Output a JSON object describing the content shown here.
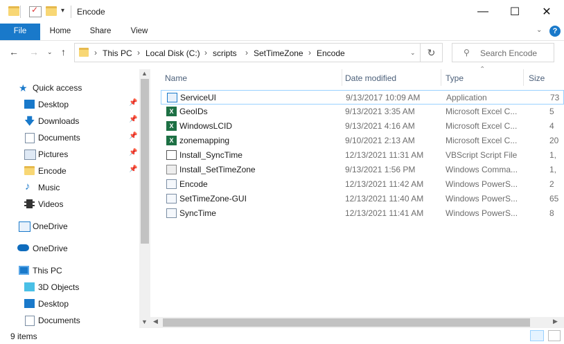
{
  "window": {
    "title": "Encode",
    "minimize": "—",
    "maximize": "☐",
    "close": "✕"
  },
  "ribbon": {
    "tabs": [
      "File",
      "Home",
      "Share",
      "View"
    ],
    "help": "?"
  },
  "address": {
    "crumbs": [
      "This PC",
      "Local Disk (C:)",
      "scripts",
      "SetTimeZone",
      "Encode"
    ],
    "search_placeholder": "Search Encode"
  },
  "nav": {
    "quick_access": "Quick access",
    "items": [
      "Desktop",
      "Downloads",
      "Documents",
      "Pictures",
      "Encode",
      "Music",
      "Videos"
    ],
    "onedrive1": "OneDrive",
    "onedrive2": "OneDrive",
    "thispc": "This PC",
    "pc_items": [
      "3D Objects",
      "Desktop",
      "Documents"
    ]
  },
  "columns": {
    "name": "Name",
    "date": "Date modified",
    "type": "Type",
    "size": "Size"
  },
  "files": [
    {
      "name": "ServiceUI",
      "date": "9/13/2017 10:09 AM",
      "type": "Application",
      "size": "73",
      "icon": "app-icon"
    },
    {
      "name": "GeoIDs",
      "date": "9/13/2021 3:35 AM",
      "type": "Microsoft Excel C...",
      "size": "5",
      "icon": "excel-icon"
    },
    {
      "name": "WindowsLCID",
      "date": "9/13/2021 4:16 AM",
      "type": "Microsoft Excel C...",
      "size": "4",
      "icon": "excel-icon"
    },
    {
      "name": "zonemapping",
      "date": "9/10/2021 2:13 AM",
      "type": "Microsoft Excel C...",
      "size": "20",
      "icon": "excel-icon"
    },
    {
      "name": "Install_SyncTime",
      "date": "12/13/2021 11:31 AM",
      "type": "VBScript Script File",
      "size": "1,",
      "icon": "vbs-icon"
    },
    {
      "name": "Install_SetTimeZone",
      "date": "9/13/2021 1:56 PM",
      "type": "Windows Comma...",
      "size": "1,",
      "icon": "cmd-icon"
    },
    {
      "name": "Encode",
      "date": "12/13/2021 11:42 AM",
      "type": "Windows PowerS...",
      "size": "2",
      "icon": "ps-icon"
    },
    {
      "name": "SetTimeZone-GUI",
      "date": "12/13/2021 11:40 AM",
      "type": "Windows PowerS...",
      "size": "65",
      "icon": "ps-icon"
    },
    {
      "name": "SyncTime",
      "date": "12/13/2021 11:41 AM",
      "type": "Windows PowerS...",
      "size": "8",
      "icon": "ps-icon"
    }
  ],
  "status": {
    "count": "9 items"
  },
  "colors": {
    "accent": "#1979ca",
    "excel": "#1d7044",
    "folder": "#f8d775"
  }
}
